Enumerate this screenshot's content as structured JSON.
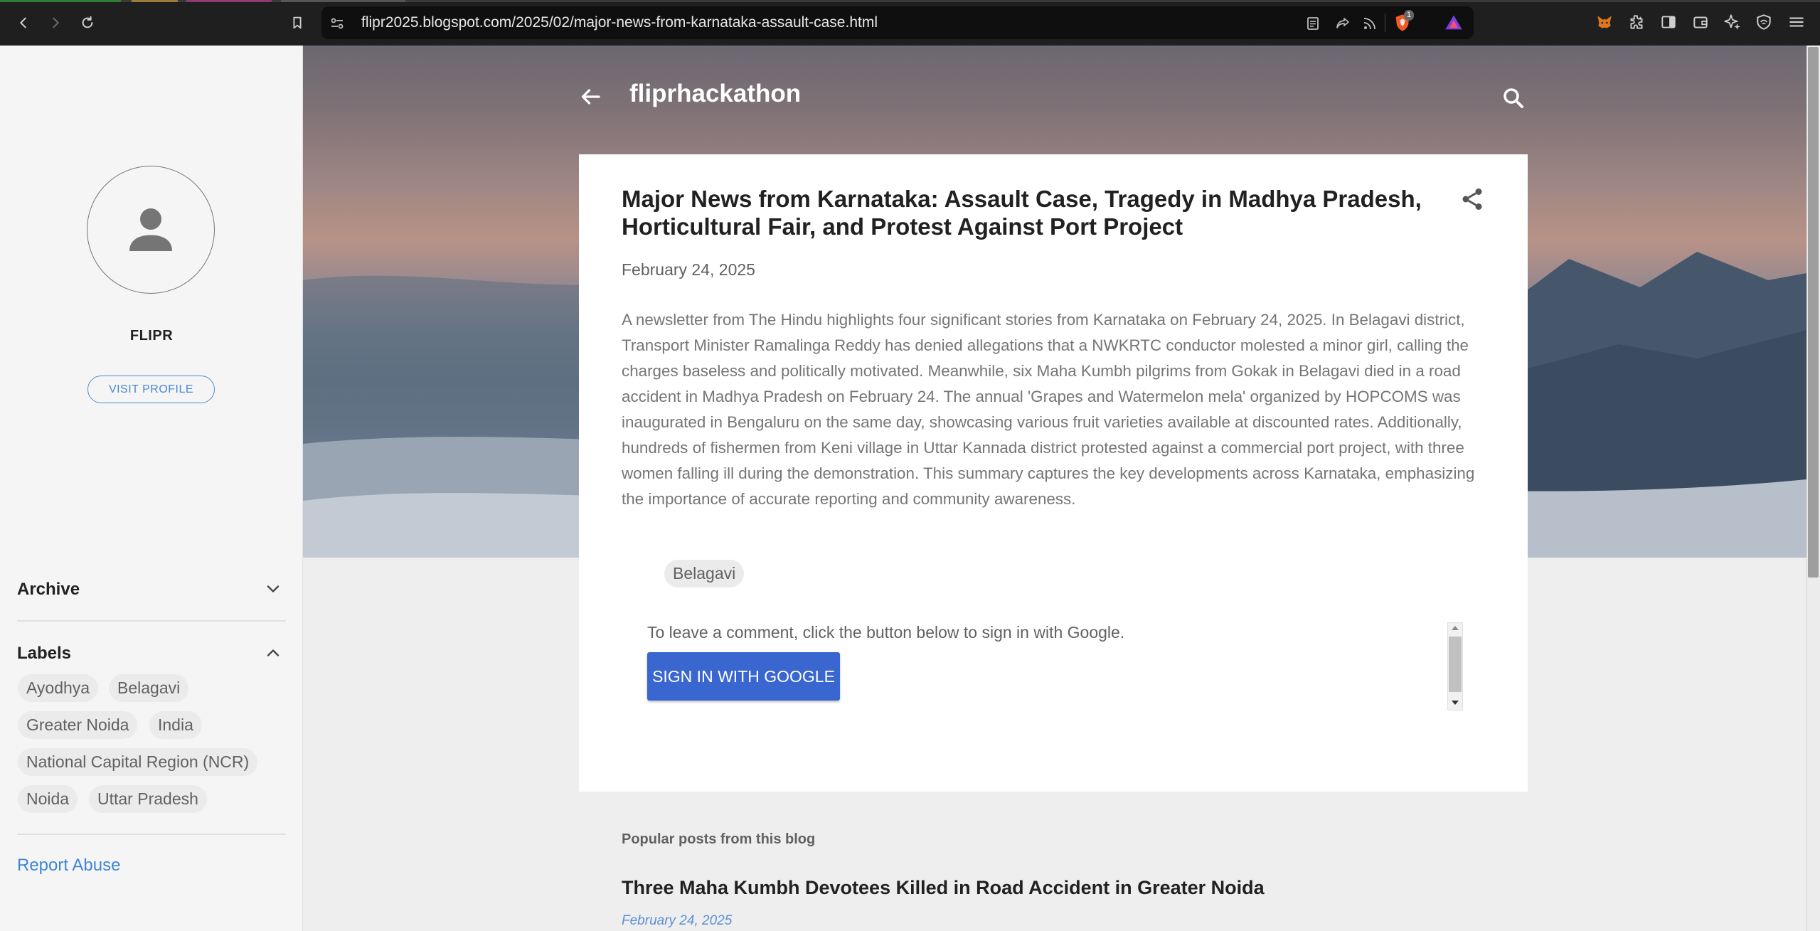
{
  "browser": {
    "url": "flipr2025.blogspot.com/2025/02/major-news-from-karnataka-assault-case.html",
    "brave_badge": "1",
    "icons": [
      "back-icon",
      "forward-icon",
      "reload-icon",
      "bookmark-icon",
      "site-settings-icon",
      "reader-mode-icon",
      "share-icon",
      "rss-icon",
      "brave-shields-icon",
      "brave-rewards-icon",
      "metamask-icon",
      "extensions-icon",
      "sidebar-icon",
      "wallet-icon",
      "leo-ai-icon",
      "vpn-icon",
      "menu-icon"
    ]
  },
  "sidebar": {
    "profile_name": "FLIPR",
    "visit_profile": "VISIT PROFILE",
    "archive_heading": "Archive",
    "labels_heading": "Labels",
    "labels": [
      "Ayodhya",
      "Belagavi",
      "Greater Noida",
      "India",
      "National Capital Region (NCR)",
      "Noida",
      "Uttar Pradesh"
    ],
    "report_abuse": "Report Abuse"
  },
  "header": {
    "blog_title": "fliprhackathon"
  },
  "post": {
    "title": "Major News from Karnataka: Assault Case, Tragedy in Madhya Pradesh, Horticultural Fair, and Protest Against Port Project",
    "date": "February 24, 2025",
    "body": "A newsletter from The Hindu highlights four significant stories from Karnataka on February 24, 2025. In Belagavi district, Transport Minister Ramalinga Reddy has denied allegations that a NWKRTC conductor molested a minor girl, calling the charges baseless and politically motivated. Meanwhile, six Maha Kumbh pilgrims from Gokak in Belagavi died in a road accident in Madhya Pradesh on February 24. The annual 'Grapes and Watermelon mela' organized by HOPCOMS was inaugurated in Bengaluru on the same day, showcasing various fruit varieties available at discounted rates. Additionally, hundreds of fishermen from Keni village in Uttar Kannada district protested against a commercial port project, with three women falling ill during the demonstration. This summary captures the key developments across Karnataka, emphasizing the importance of accurate reporting and community awareness.",
    "tag": "Belagavi",
    "comment_note": "To leave a comment, click the button below to sign in with Google.",
    "signin_button": "SIGN IN WITH GOOGLE"
  },
  "popular": {
    "heading": "Popular posts from this blog",
    "title": "Three Maha Kumbh Devotees Killed in Road Accident in Greater Noida",
    "date": "February 24, 2025"
  },
  "colors": {
    "accent_link": "#3f86d9",
    "signin_button": "#3a66d0",
    "chrome_bg": "#1f1f1f"
  }
}
